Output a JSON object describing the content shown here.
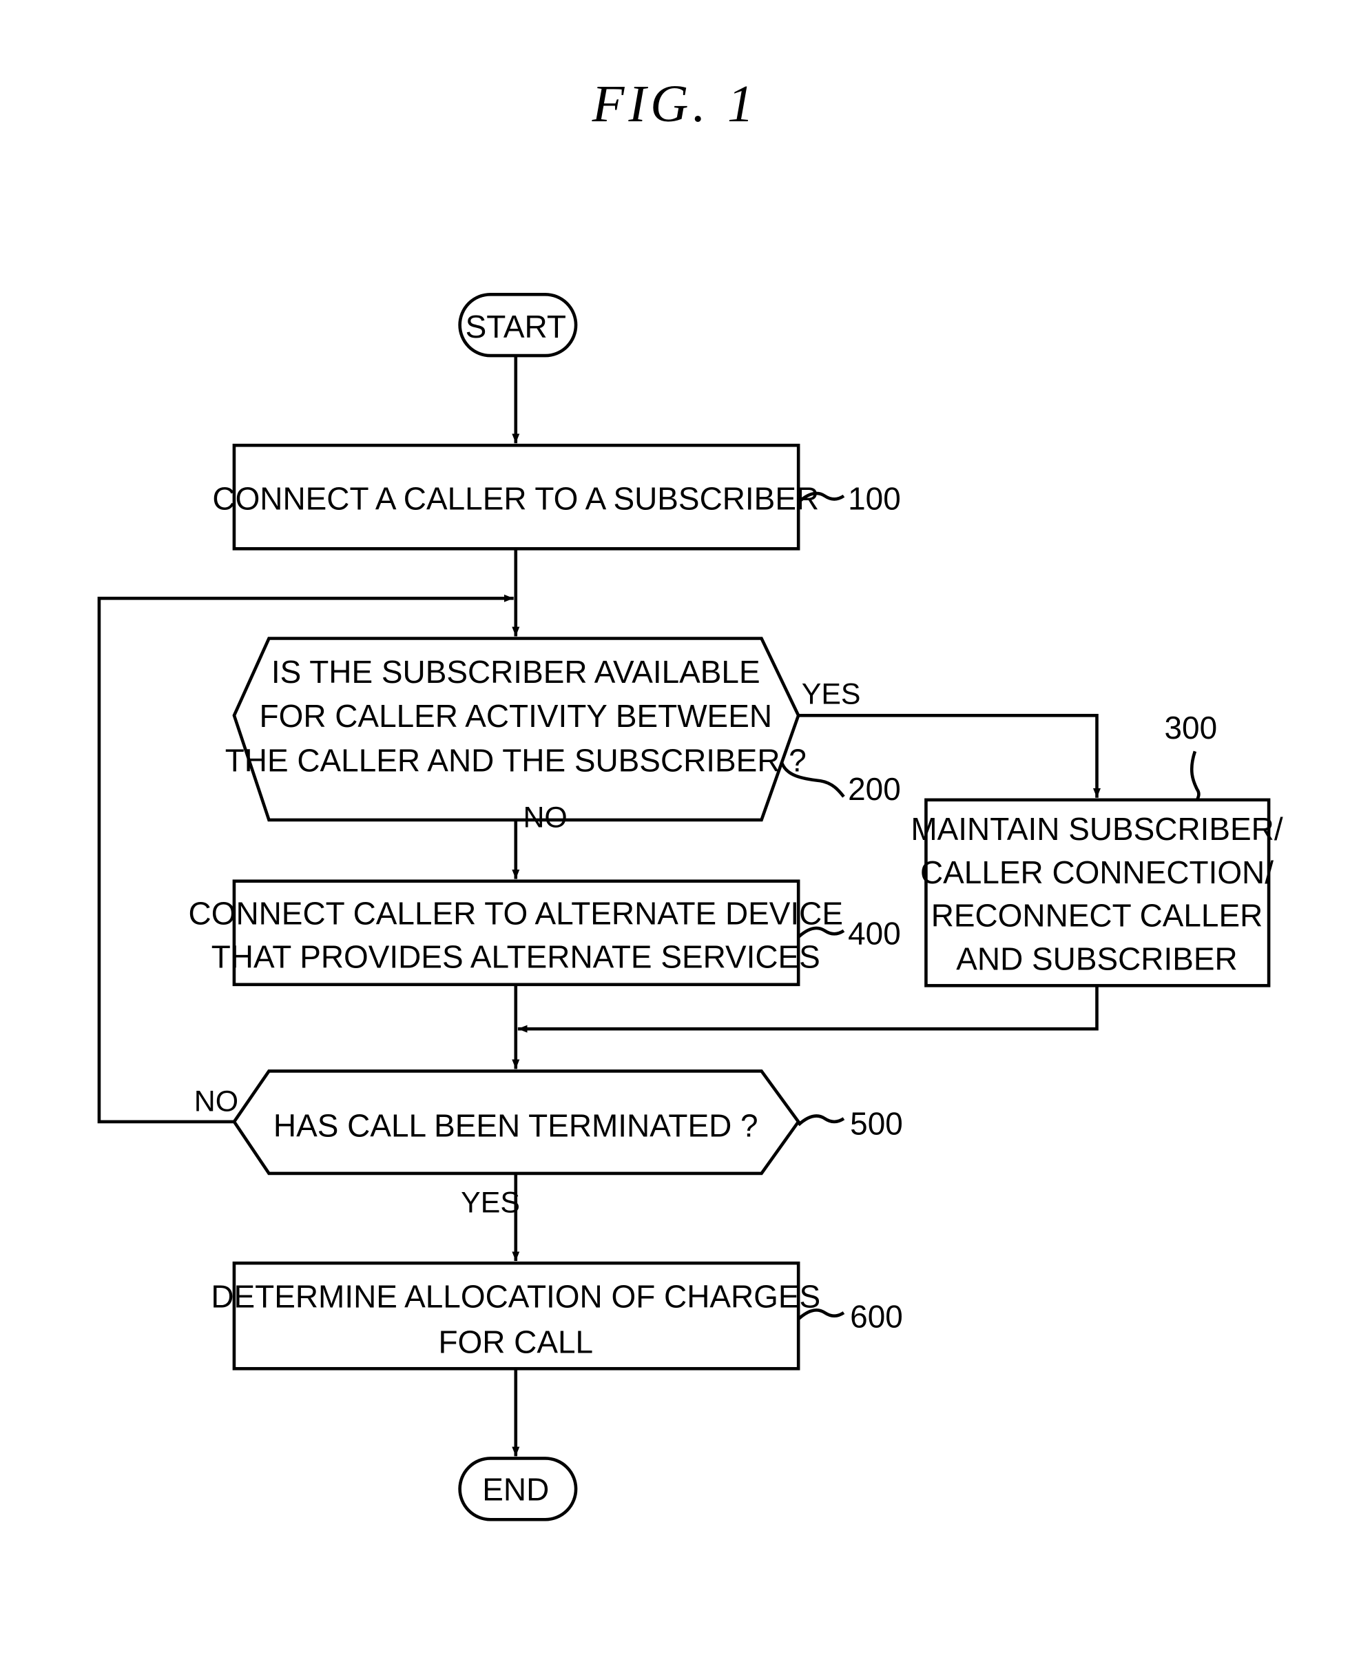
{
  "figure": {
    "title": "FIG. 1"
  },
  "terminals": {
    "start": "START",
    "end": "END"
  },
  "steps": {
    "s100": {
      "ref": "100",
      "lines": [
        "CONNECT A CALLER TO A SUBSCRIBER"
      ]
    },
    "s200": {
      "ref": "200",
      "lines": [
        "IS THE SUBSCRIBER AVAILABLE",
        "FOR CALLER ACTIVITY BETWEEN",
        "THE CALLER AND THE SUBSCRIBER ?"
      ]
    },
    "s300": {
      "ref": "300",
      "lines": [
        "MAINTAIN SUBSCRIBER/",
        "CALLER CONNECTION/",
        "RECONNECT CALLER",
        "AND SUBSCRIBER"
      ]
    },
    "s400": {
      "ref": "400",
      "lines": [
        "CONNECT CALLER TO ALTERNATE DEVICE",
        "THAT PROVIDES ALTERNATE SERVICES"
      ]
    },
    "s500": {
      "ref": "500",
      "lines": [
        "HAS CALL BEEN TERMINATED ?"
      ]
    },
    "s600": {
      "ref": "600",
      "lines": [
        "DETERMINE ALLOCATION OF CHARGES",
        "FOR CALL"
      ]
    }
  },
  "branches": {
    "s200_yes": "YES",
    "s200_no": "NO",
    "s500_no": "NO",
    "s500_yes": "YES"
  }
}
